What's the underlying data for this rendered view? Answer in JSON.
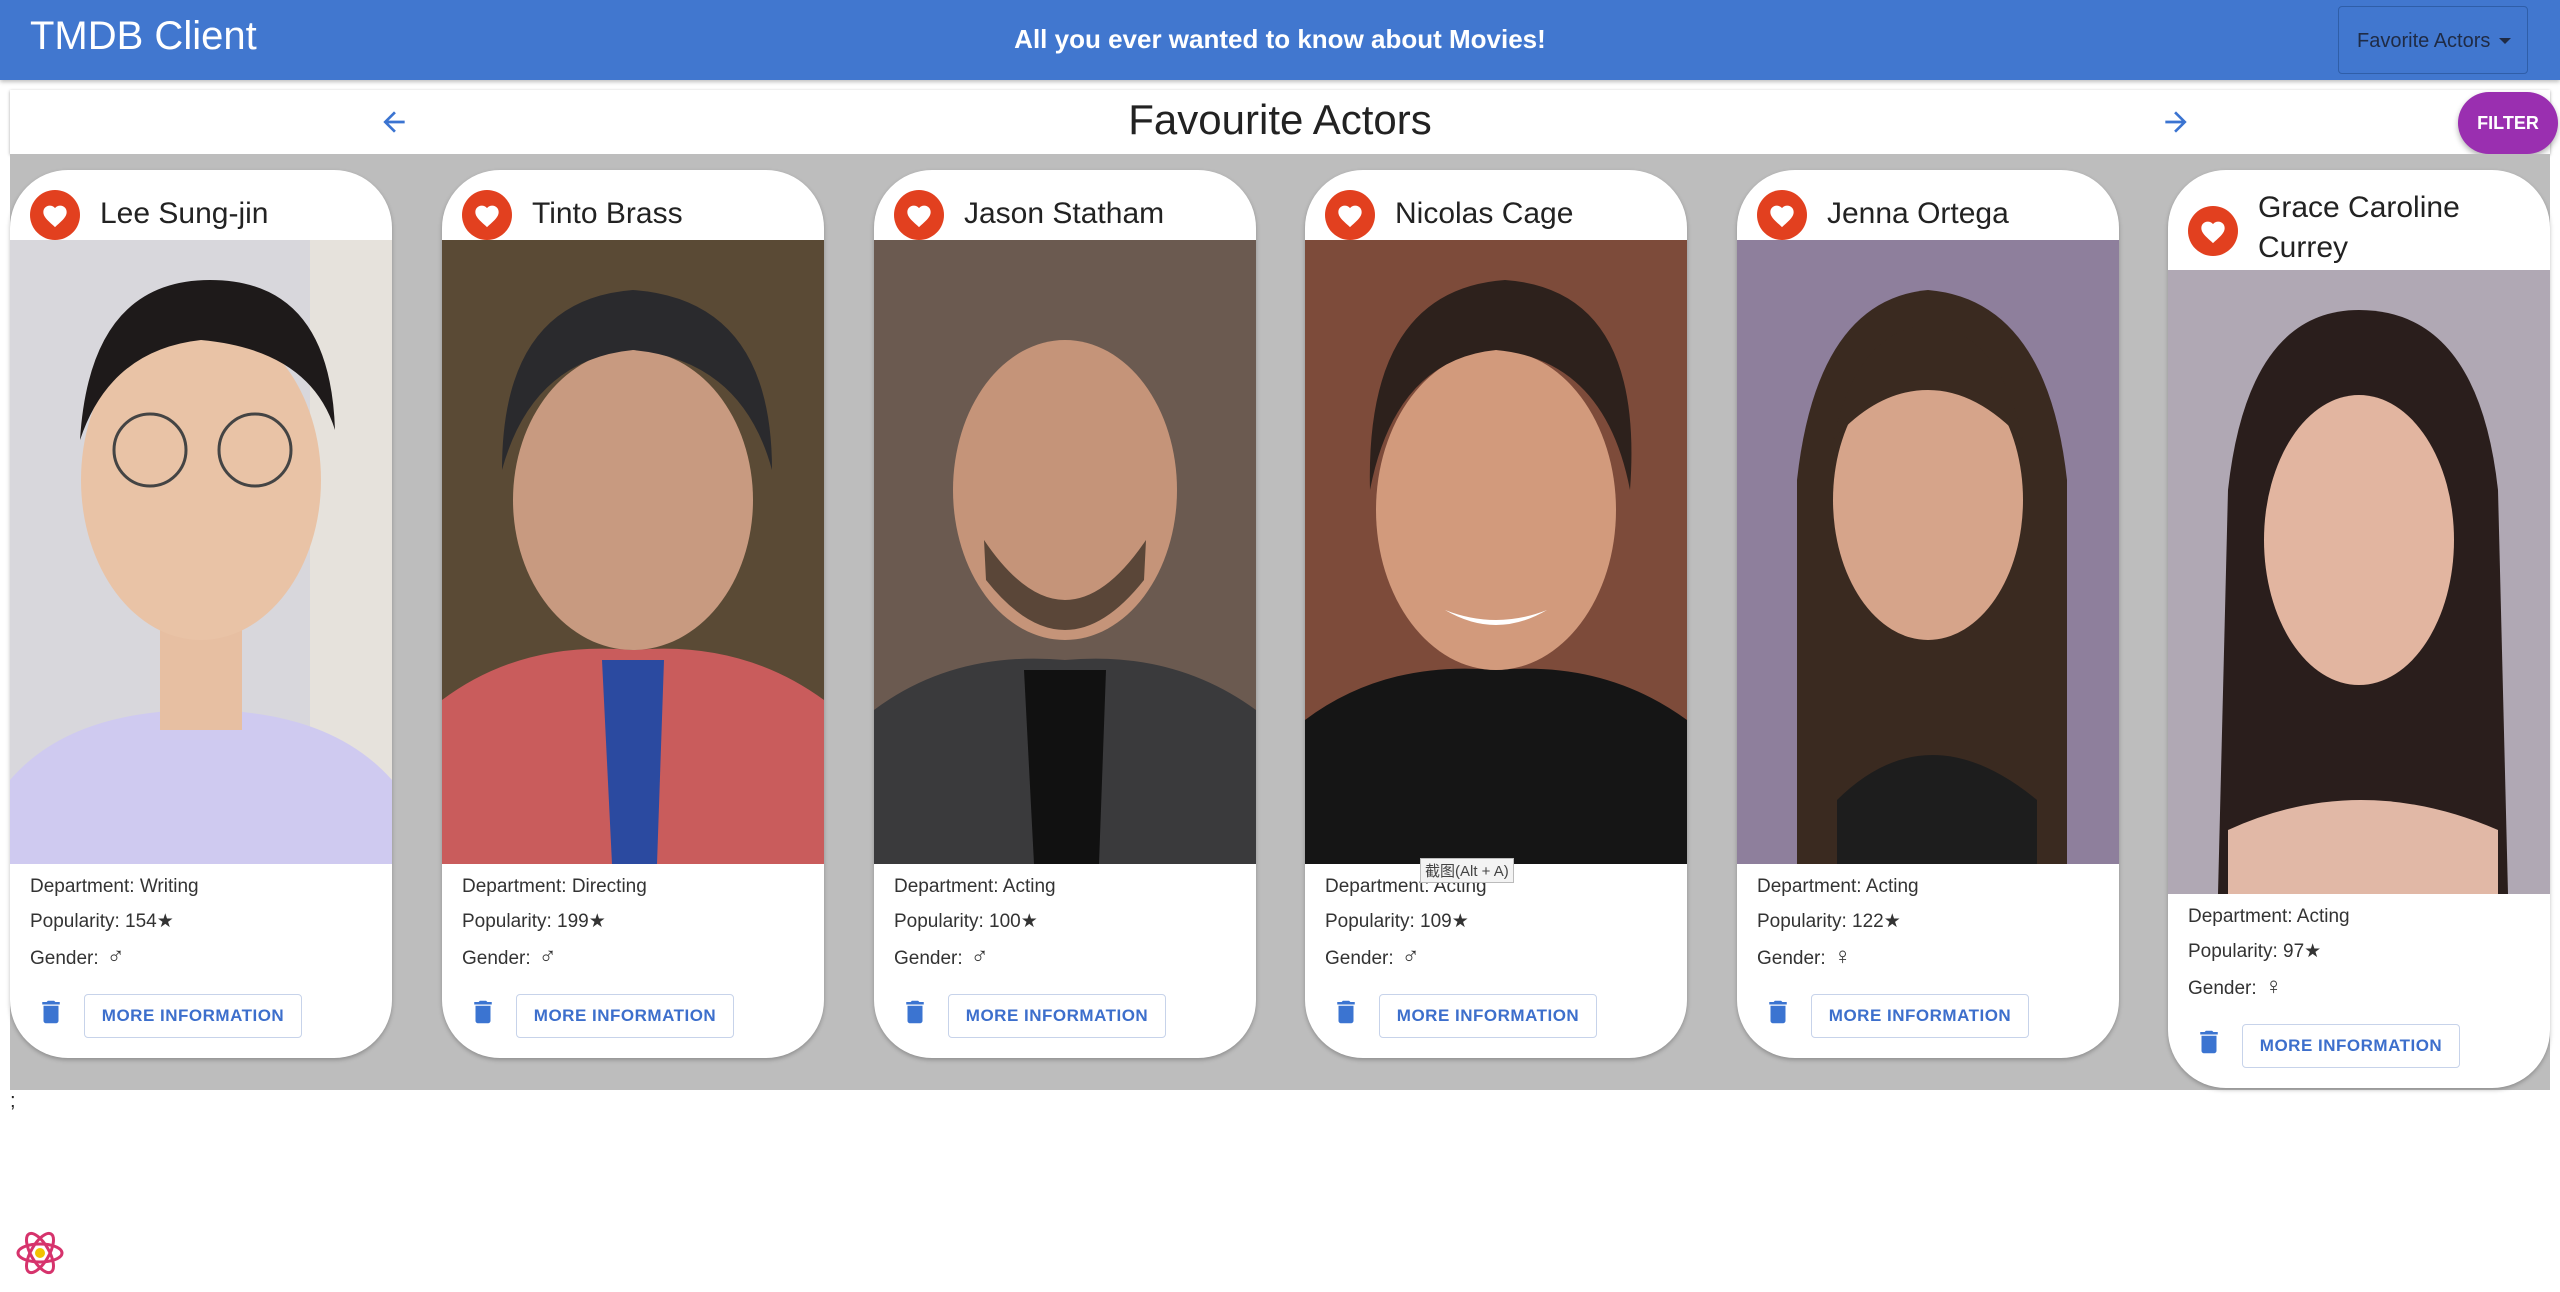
{
  "appbar": {
    "title": "TMDB Client",
    "tagline": "All you ever wanted to know about Movies!",
    "menu_label": "Favorite Actors",
    "color": "#4177cf"
  },
  "page": {
    "heading": "Favourite Actors",
    "filter_label": "FILTER",
    "filter_color": "#9a2fb0",
    "prev_icon": "arrow-left-icon",
    "next_icon": "arrow-right-icon"
  },
  "actors": [
    {
      "name": "Lee Sung-jin",
      "department": "Department: Writing",
      "popularity": "Popularity: 154★",
      "gender_label": "Gender:",
      "gender_symbol": "♂",
      "more_label": "MORE INFORMATION"
    },
    {
      "name": "Tinto Brass",
      "department": "Department: Directing",
      "popularity": "Popularity: 199★",
      "gender_label": "Gender:",
      "gender_symbol": "♂",
      "more_label": "MORE INFORMATION"
    },
    {
      "name": "Jason Statham",
      "department": "Department: Acting",
      "popularity": "Popularity: 100★",
      "gender_label": "Gender:",
      "gender_symbol": "♂",
      "more_label": "MORE INFORMATION"
    },
    {
      "name": "Nicolas Cage",
      "department": "Department: Acting",
      "popularity": "Popularity: 109★",
      "gender_label": "Gender:",
      "gender_symbol": "♂",
      "more_label": "MORE INFORMATION"
    },
    {
      "name": "Jenna Ortega",
      "department": "Department: Acting",
      "popularity": "Popularity: 122★",
      "gender_label": "Gender:",
      "gender_symbol": "♀",
      "more_label": "MORE INFORMATION"
    },
    {
      "name": "Grace Caroline Currey",
      "department": "Department: Acting",
      "popularity": "Popularity: 97★",
      "gender_label": "Gender:",
      "gender_symbol": "♀",
      "more_label": "MORE INFORMATION"
    }
  ],
  "tooltip": "截图(Alt + A)",
  "footer_text": ";",
  "favourite_color": "#e2401f",
  "delete_icon": "trash-icon",
  "favourite_icon": "heart-icon",
  "logo_icon": "react-logo-icon"
}
